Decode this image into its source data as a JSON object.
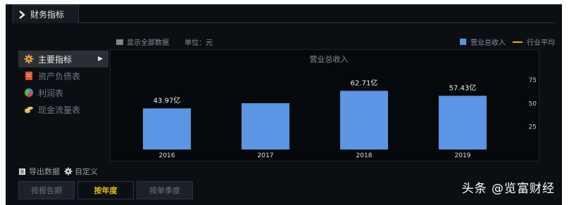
{
  "header": {
    "title": "财务指标"
  },
  "sidebar": {
    "items": [
      {
        "label": "主要指标",
        "active": true,
        "icon": "gear-icon"
      },
      {
        "label": "资产负债表",
        "active": false,
        "icon": "document-icon"
      },
      {
        "label": "利润表",
        "active": false,
        "icon": "pie-icon"
      },
      {
        "label": "现金流量表",
        "active": false,
        "icon": "coins-icon"
      }
    ]
  },
  "chart_header": {
    "show_all_label": "显示全部数据",
    "unit_label": "单位：元",
    "legend_revenue": "营业总收入",
    "legend_avg": "行业平均"
  },
  "chart_data": {
    "type": "bar",
    "title": "营业总收入",
    "categories": [
      "2016",
      "2017",
      "2018",
      "2019"
    ],
    "values": [
      43.97,
      49.5,
      62.71,
      57.43
    ],
    "data_labels": [
      "43.97亿",
      "",
      "62.71亿",
      "57.43亿"
    ],
    "y_ticks": [
      25,
      50,
      75
    ],
    "ylim": [
      0,
      90
    ],
    "bar_color": "#5b95e3",
    "avg_line_color": "#e8b400"
  },
  "tools": {
    "export_label": "导出数据",
    "custom_label": "自定义"
  },
  "tabs": [
    {
      "label": "按报告期",
      "active": false
    },
    {
      "label": "按年度",
      "active": true
    },
    {
      "label": "按单季度",
      "active": false
    }
  ],
  "watermark": "头条 @览富财经"
}
